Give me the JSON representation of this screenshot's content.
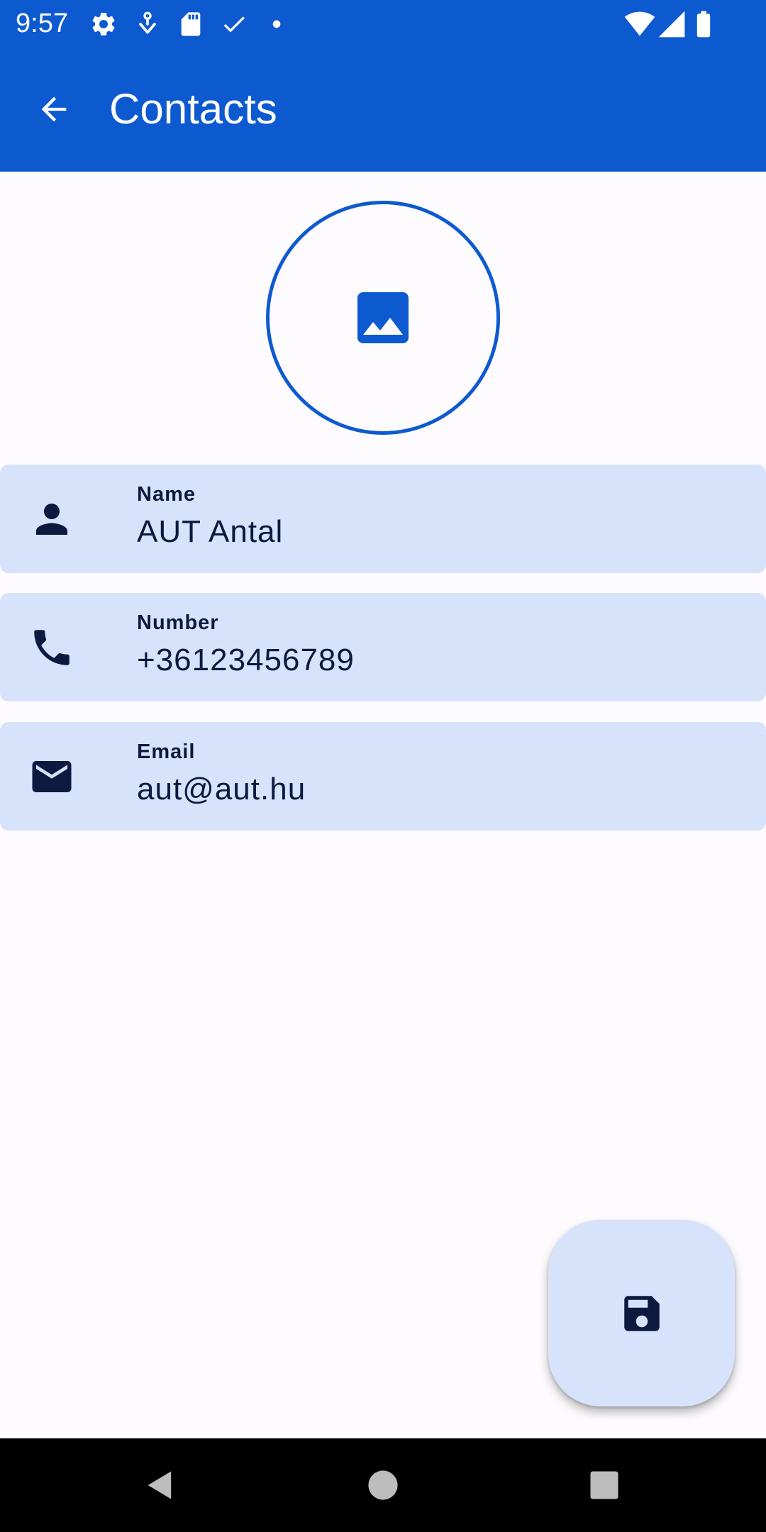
{
  "status_bar": {
    "time": "9:57",
    "left_icons": [
      "gear-icon",
      "notification-icon",
      "sd-card-icon",
      "check-icon",
      "dot-icon"
    ],
    "right_icons": [
      "wifi-icon",
      "signal-icon",
      "battery-icon"
    ]
  },
  "app_bar": {
    "title": "Contacts",
    "back_icon": "arrow-back-icon"
  },
  "avatar": {
    "icon": "image-icon"
  },
  "fields": [
    {
      "label": "Name",
      "value": "AUT Antal",
      "icon": "person-icon"
    },
    {
      "label": "Number",
      "value": "+36123456789",
      "icon": "phone-icon"
    },
    {
      "label": "Email",
      "value": "aut@aut.hu",
      "icon": "mail-icon"
    }
  ],
  "fab": {
    "icon": "save-icon"
  },
  "nav_bar": {
    "buttons": [
      "back-triangle-icon",
      "home-circle-icon",
      "recents-square-icon"
    ]
  },
  "colors": {
    "primary": "#0d5ad0",
    "card_background": "#d6e3fb",
    "on_card": "#0b1a3e",
    "background": "#fefbff"
  }
}
